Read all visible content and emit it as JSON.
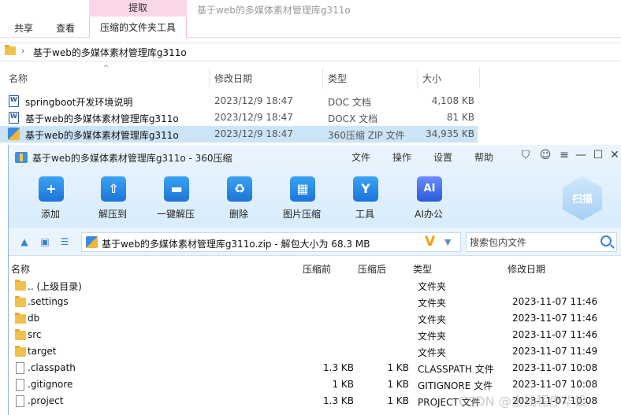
{
  "explorer": {
    "context_tab_header": "提取",
    "window_title": "基于web的多媒体素材管理库g311o",
    "tabs": [
      "共享",
      "查看",
      "压缩的文件夹工具"
    ],
    "address_path": "基于web的多媒体素材管理库g311o",
    "columns": [
      "名称",
      "修改日期",
      "类型",
      "大小"
    ],
    "files": [
      {
        "name": "springboot开发环境说明",
        "date": "2023/12/9 18:47",
        "type": "DOC 文档",
        "size": "4,108 KB",
        "icon": "word-doc-icon"
      },
      {
        "name": "基于web的多媒体素材管理库g311o",
        "date": "2023/12/9 18:47",
        "type": "DOCX 文档",
        "size": "81 KB",
        "icon": "word-doc-icon"
      },
      {
        "name": "基于web的多媒体素材管理库g311o",
        "date": "2023/12/9 18:47",
        "type": "360压缩 ZIP 文件",
        "size": "34,935 KB",
        "icon": "zip-archive-icon"
      }
    ]
  },
  "zip": {
    "title": "基于web的多媒体素材管理库g311o - 360压缩",
    "menu": [
      "文件",
      "操作",
      "设置",
      "帮助"
    ],
    "window_controls": [
      "shirt-skin-icon",
      "smile-feedback-icon",
      "menu-icon",
      "minimize-icon",
      "maximize-icon",
      "close-icon"
    ],
    "toolbar": [
      {
        "label": "添加",
        "icon": "add-icon",
        "glyph": "+"
      },
      {
        "label": "解压到",
        "icon": "extract-to-icon",
        "glyph": "⇧"
      },
      {
        "label": "一键解压",
        "icon": "one-click-extract-icon",
        "glyph": "▬"
      },
      {
        "label": "删除",
        "icon": "recycle-bin-icon",
        "glyph": "♻"
      },
      {
        "label": "图片压缩",
        "icon": "image-compress-icon",
        "glyph": "▦"
      },
      {
        "label": "工具",
        "icon": "tools-icon",
        "glyph": "Y"
      },
      {
        "label": "AI办公",
        "icon": "ai-office-icon",
        "glyph": "AI"
      }
    ],
    "scan_label": "扫描",
    "path_text": "基于web的多媒体素材管理库g311o.zip - 解包大小为 68.3 MB",
    "path_badge": "V",
    "search_placeholder": "搜索包内文件",
    "columns": [
      "名称",
      "压缩前",
      "压缩后",
      "类型",
      "修改日期"
    ],
    "files": [
      {
        "name": ".. (上级目录)",
        "comp": "",
        "orig": "",
        "type": "文件夹",
        "date": "",
        "kind": "folder"
      },
      {
        "name": ".settings",
        "comp": "",
        "orig": "",
        "type": "文件夹",
        "date": "2023-11-07 11:46",
        "kind": "folder"
      },
      {
        "name": "db",
        "comp": "",
        "orig": "",
        "type": "文件夹",
        "date": "2023-11-07 11:46",
        "kind": "folder"
      },
      {
        "name": "src",
        "comp": "",
        "orig": "",
        "type": "文件夹",
        "date": "2023-11-07 11:46",
        "kind": "folder"
      },
      {
        "name": "target",
        "comp": "",
        "orig": "",
        "type": "文件夹",
        "date": "2023-11-07 11:49",
        "kind": "folder"
      },
      {
        "name": ".classpath",
        "comp": "1.3 KB",
        "orig": "1 KB",
        "type": "CLASSPATH 文件",
        "date": "2023-11-07 10:08",
        "kind": "file"
      },
      {
        "name": ".gitignore",
        "comp": "1 KB",
        "orig": "1 KB",
        "type": "GITIGNORE 文件",
        "date": "2023-11-07 10:08",
        "kind": "file"
      },
      {
        "name": ".project",
        "comp": "1.3 KB",
        "orig": "1 KB",
        "type": "PROJECT 文件",
        "date": "2023-11-07 10:08",
        "kind": "file"
      }
    ]
  },
  "watermark": "CSDN @全栈程序华设"
}
